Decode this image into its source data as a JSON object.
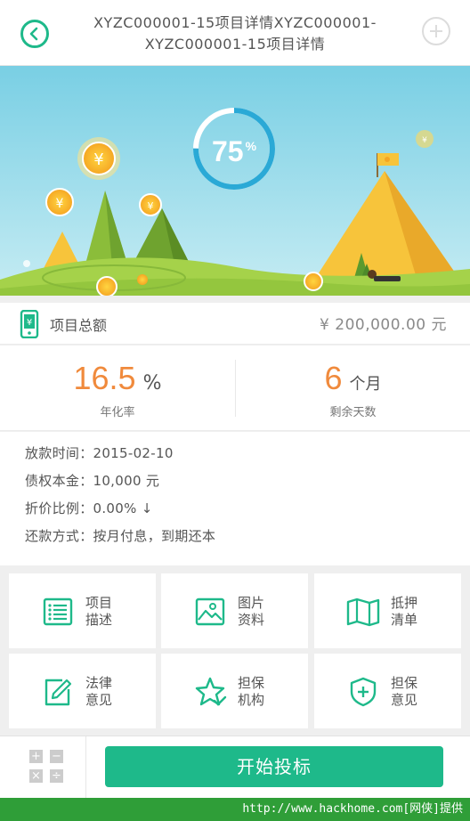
{
  "header": {
    "title": "XYZC000001-15项目详情XYZC000001-XYZC000001-15项目详情"
  },
  "banner": {
    "progress_value": "75",
    "progress_unit": "%",
    "progress_fraction": 0.75
  },
  "amount": {
    "label": "项目总额",
    "value": "¥ 200,000.00 元"
  },
  "stats": {
    "rate": {
      "value": "16.5",
      "unit": "%",
      "label": "年化率"
    },
    "days": {
      "value": "6",
      "unit": "个月",
      "label": "剩余天数"
    }
  },
  "details": {
    "loan_date": "放款时间：2015-02-10",
    "principal": "债权本金：10,000 元",
    "discount": "折价比例：0.00% ↓",
    "repayment": "还款方式：按月付息，到期还本"
  },
  "grid": {
    "items": [
      {
        "label": "项目描述",
        "icon": "list-icon"
      },
      {
        "label": "图片资料",
        "icon": "picture-icon"
      },
      {
        "label": "抵押清单",
        "icon": "map-icon"
      },
      {
        "label": "法律意见",
        "icon": "edit-icon"
      },
      {
        "label": "担保机构",
        "icon": "star-check-icon"
      },
      {
        "label": "担保意见",
        "icon": "shield-plus-icon"
      }
    ]
  },
  "bottom": {
    "invest_label": "开始投标",
    "calc_keys": [
      "+",
      "−",
      "×",
      "÷"
    ]
  },
  "watermark": "http://www.hackhome.com[网侠]提供",
  "colors": {
    "accent": "#1eb98a",
    "orange": "#f08a3c"
  }
}
